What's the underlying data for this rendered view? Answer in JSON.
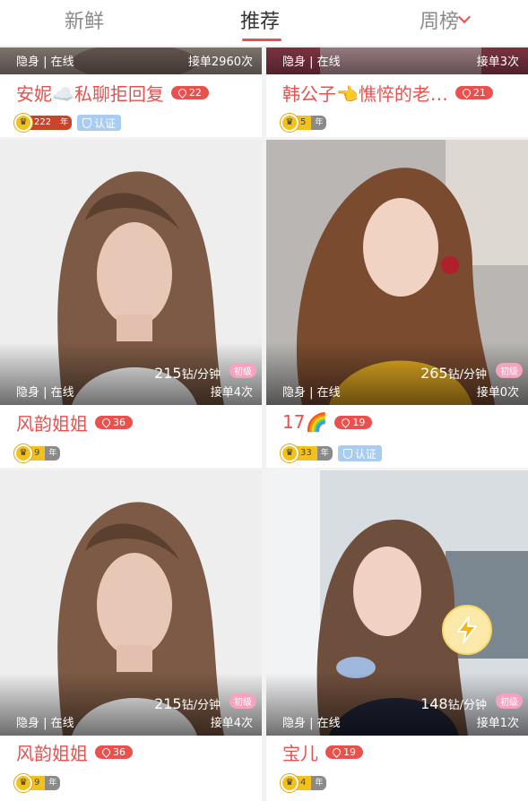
{
  "tabs": [
    {
      "label": "新鲜",
      "active": false
    },
    {
      "label": "推荐",
      "active": true
    },
    {
      "label": "周榜",
      "active": false
    }
  ],
  "cards": [
    {
      "name": "安妮☁️私聊拒回复",
      "distance": "22",
      "status": "隐身 | 在线",
      "orders": "接单2960次",
      "vip_level": "222",
      "vip_unit": "年",
      "verified": "认证"
    },
    {
      "name": "韩公子👈憔悴的老…",
      "distance": "21",
      "status": "隐身 | 在线",
      "orders": "接单3次",
      "vip_level": "5",
      "vip_unit": "年"
    },
    {
      "name": "风韵姐姐",
      "distance": "36",
      "status": "隐身 | 在线",
      "orders": "接单4次",
      "price": "215",
      "price_unit": "钻/分钟",
      "level": "初级",
      "vip_level": "9",
      "vip_unit": "年"
    },
    {
      "name": "17🌈",
      "distance": "19",
      "status": "隐身 | 在线",
      "orders": "接单0次",
      "price": "265",
      "price_unit": "钻/分钟",
      "level": "初级",
      "vip_level": "33",
      "vip_unit": "年",
      "verified": "认证"
    },
    {
      "name": "风韵姐姐",
      "distance": "36",
      "status": "隐身 | 在线",
      "orders": "接单4次",
      "price": "215",
      "price_unit": "钻/分钟",
      "level": "初级",
      "vip_level": "9",
      "vip_unit": "年"
    },
    {
      "name": "宝儿",
      "distance": "19",
      "status": "隐身 | 在线",
      "orders": "接单1次",
      "price": "148",
      "price_unit": "钻/分钟",
      "level": "初级",
      "vip_level": "4",
      "vip_unit": "年"
    }
  ],
  "icons": {
    "crown": "crown-icon",
    "pin": "location-pin-icon",
    "shield": "shield-check-icon",
    "flash": "lightning-icon"
  },
  "colors": {
    "accent": "#e8514e",
    "level_badge": "#f7a3c0",
    "vip_gold": "#f3c11c",
    "verified": "#a9ccf2"
  }
}
